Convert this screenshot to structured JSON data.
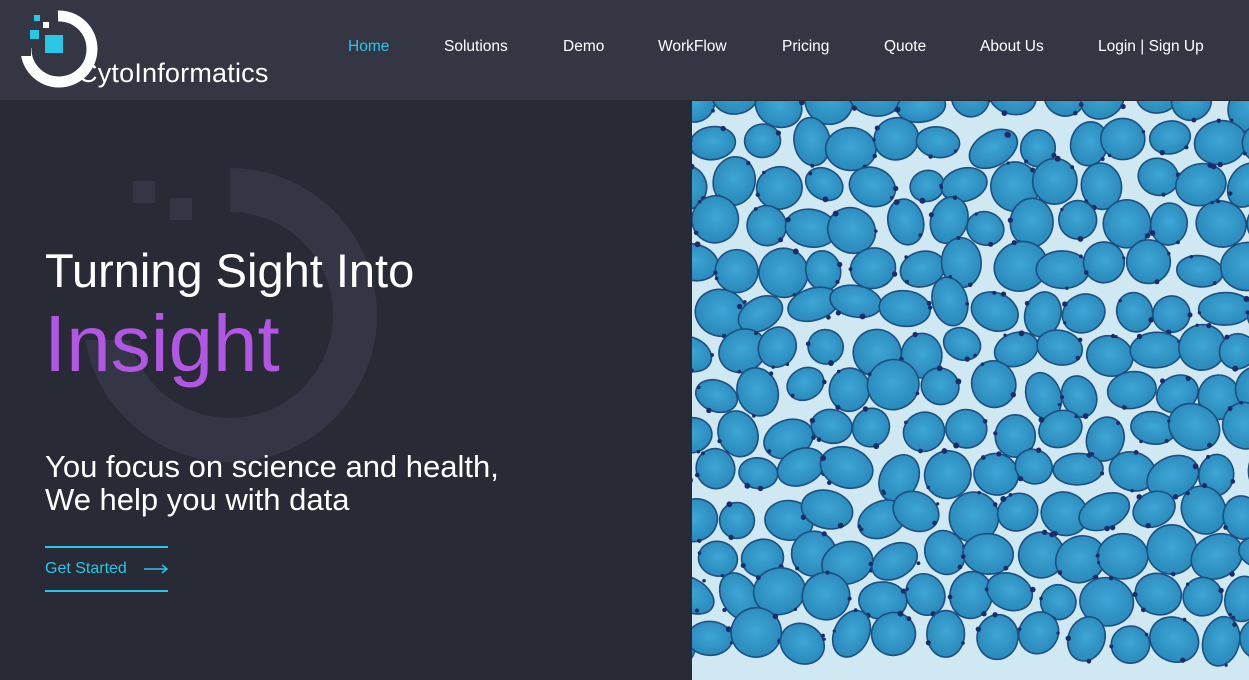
{
  "brand": {
    "name": "CytoInformatics",
    "accent_color": "#2bc5e6",
    "highlight_color": "#b257e3"
  },
  "nav": {
    "items": [
      {
        "label": "Home",
        "active": true
      },
      {
        "label": "Solutions"
      },
      {
        "label": "Demo"
      },
      {
        "label": "WorkFlow"
      },
      {
        "label": "Pricing"
      },
      {
        "label": "Quote"
      },
      {
        "label": "About Us"
      },
      {
        "label": "Login | Sign Up"
      }
    ]
  },
  "hero": {
    "title": "Turning Sight Into",
    "accent": "Insight",
    "subtitle_line1": "You focus on science and health,",
    "subtitle_line2": "We help you with data",
    "cta_label": "Get Started",
    "cta_icon": "arrow-right-icon"
  },
  "media": {
    "icon": "tissue-micrograph-image",
    "base_color": "#2a93c4"
  }
}
